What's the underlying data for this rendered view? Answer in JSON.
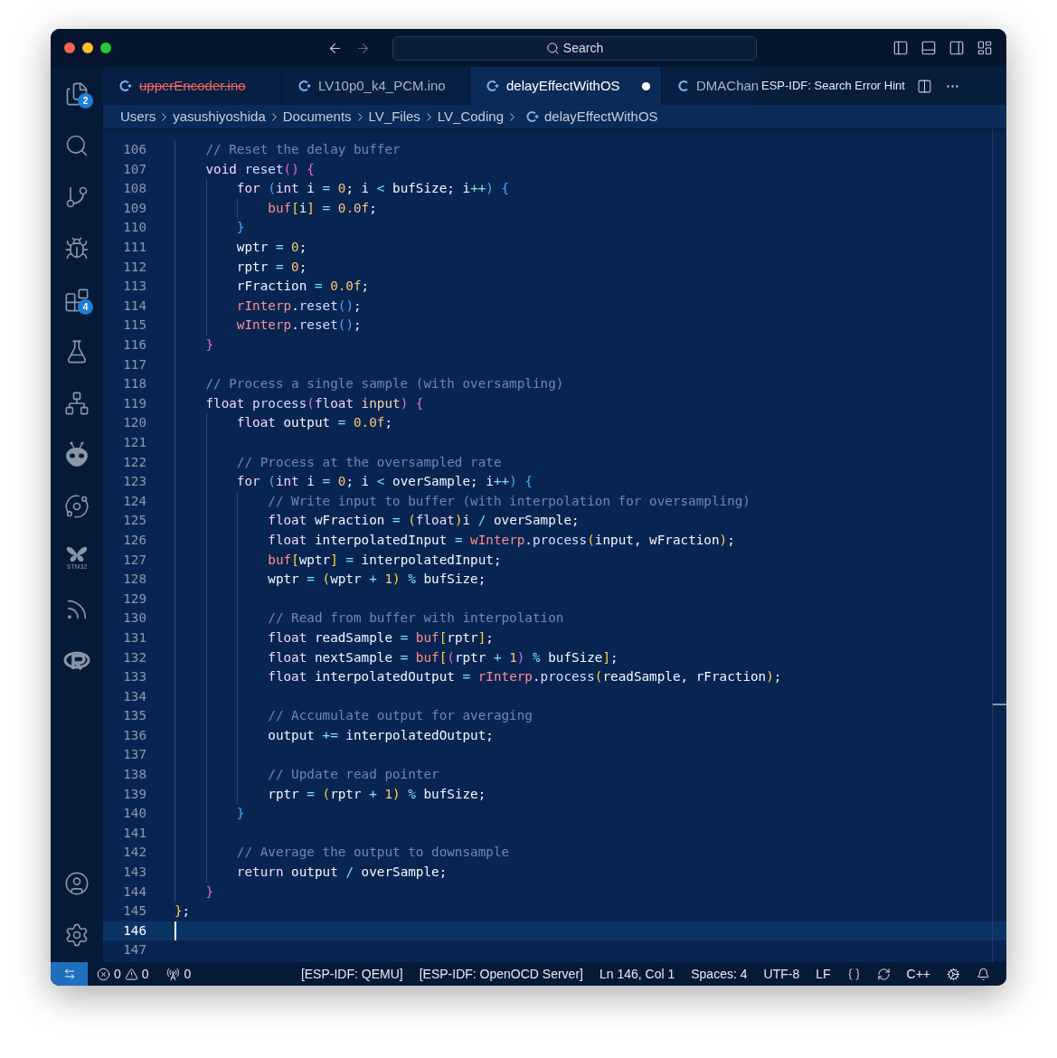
{
  "title_bar": {
    "search": {
      "placeholder": "Search"
    }
  },
  "activity_bar": {
    "items": [
      {
        "kind": "files",
        "badge": "2"
      },
      {
        "kind": "search"
      },
      {
        "kind": "branch"
      },
      {
        "kind": "debug"
      },
      {
        "kind": "extensions",
        "badge": "4"
      },
      {
        "kind": "flask"
      },
      {
        "kind": "circuit"
      },
      {
        "kind": "alien"
      },
      {
        "kind": "swirl"
      },
      {
        "kind": "butterfly",
        "caption": "STM32"
      },
      {
        "kind": "signal"
      },
      {
        "kind": "rlogo"
      }
    ],
    "bottom_items": [
      {
        "kind": "account"
      },
      {
        "kind": "settings"
      }
    ]
  },
  "tabs": [
    {
      "label": "upperEncoder.ino",
      "kind": "cpp",
      "selected": false,
      "modified": false,
      "deleted": true
    },
    {
      "label": "LV10p0_k4_PCM.ino",
      "kind": "cpp",
      "selected": false,
      "modified": false,
      "deleted": false
    },
    {
      "label": "delayEffectWithOS",
      "kind": "cpp",
      "selected": true,
      "modified": true,
      "deleted": false
    },
    {
      "label": "DMAChan",
      "kind": "c",
      "selected": false,
      "modified": false,
      "deleted": false
    }
  ],
  "editor_actions": {
    "hint": "ESP-IDF: Search Error Hint"
  },
  "breadcrumb": [
    {
      "label": "Users",
      "kind": "folder"
    },
    {
      "label": "yasushiyoshida",
      "kind": "folder"
    },
    {
      "label": "Documents",
      "kind": "folder"
    },
    {
      "label": "LV_Files",
      "kind": "folder"
    },
    {
      "label": "LV_Coding",
      "kind": "folder"
    },
    {
      "label": "delayEffectWithOS",
      "kind": "cpp"
    }
  ],
  "editor": {
    "lines": [
      {
        "number": "106",
        "current": false,
        "tokens": [
          {
            "text": "    // Reset the delay buffer",
            "kind": "comment"
          }
        ]
      },
      {
        "number": "107",
        "current": false,
        "tokens": [
          {
            "text": "    void",
            "kind": "keyword"
          },
          {
            "text": " reset",
            "kind": "function"
          },
          {
            "text": "()",
            "kind": "pink"
          },
          {
            "text": " {",
            "kind": "pink"
          }
        ]
      },
      {
        "number": "108",
        "current": false,
        "tokens": [
          {
            "text": "        for",
            "kind": "keyword"
          },
          {
            "text": " (",
            "kind": "blue"
          },
          {
            "text": "int",
            "kind": "keyword"
          },
          {
            "text": " i ",
            "kind": "plain"
          },
          {
            "text": "=",
            "kind": "operator"
          },
          {
            "text": " 0",
            "kind": "number"
          },
          {
            "text": "; i ",
            "kind": "plain"
          },
          {
            "text": "<",
            "kind": "operator"
          },
          {
            "text": " bufSize; i",
            "kind": "plain"
          },
          {
            "text": "++",
            "kind": "operator"
          },
          {
            "text": ")",
            "kind": "blue"
          },
          {
            "text": " {",
            "kind": "blue"
          }
        ]
      },
      {
        "number": "109",
        "current": false,
        "tokens": [
          {
            "text": "            buf",
            "kind": "member"
          },
          {
            "text": "[",
            "kind": "gold"
          },
          {
            "text": "i",
            "kind": "plain"
          },
          {
            "text": "]",
            "kind": "gold"
          },
          {
            "text": " =",
            "kind": "operator"
          },
          {
            "text": " 0.0f",
            "kind": "number"
          },
          {
            "text": ";",
            "kind": "plain"
          }
        ]
      },
      {
        "number": "110",
        "current": false,
        "tokens": [
          {
            "text": "        }",
            "kind": "blue"
          }
        ]
      },
      {
        "number": "111",
        "current": false,
        "tokens": [
          {
            "text": "        wptr ",
            "kind": "plain"
          },
          {
            "text": "=",
            "kind": "operator"
          },
          {
            "text": " 0",
            "kind": "number"
          },
          {
            "text": ";",
            "kind": "plain"
          }
        ]
      },
      {
        "number": "112",
        "current": false,
        "tokens": [
          {
            "text": "        rptr ",
            "kind": "plain"
          },
          {
            "text": "=",
            "kind": "operator"
          },
          {
            "text": " 0",
            "kind": "number"
          },
          {
            "text": ";",
            "kind": "plain"
          }
        ]
      },
      {
        "number": "113",
        "current": false,
        "tokens": [
          {
            "text": "        rFraction ",
            "kind": "plain"
          },
          {
            "text": "=",
            "kind": "operator"
          },
          {
            "text": " 0.0f",
            "kind": "number"
          },
          {
            "text": ";",
            "kind": "plain"
          }
        ]
      },
      {
        "number": "114",
        "current": false,
        "tokens": [
          {
            "text": "        rInterp",
            "kind": "member"
          },
          {
            "text": ".",
            "kind": "plain"
          },
          {
            "text": "reset",
            "kind": "function"
          },
          {
            "text": "()",
            "kind": "blue"
          },
          {
            "text": ";",
            "kind": "plain"
          }
        ]
      },
      {
        "number": "115",
        "current": false,
        "tokens": [
          {
            "text": "        wInterp",
            "kind": "member"
          },
          {
            "text": ".",
            "kind": "plain"
          },
          {
            "text": "reset",
            "kind": "function"
          },
          {
            "text": "()",
            "kind": "blue"
          },
          {
            "text": ";",
            "kind": "plain"
          }
        ]
      },
      {
        "number": "116",
        "current": false,
        "tokens": [
          {
            "text": "    }",
            "kind": "pink"
          }
        ]
      },
      {
        "number": "117",
        "current": false
      },
      {
        "number": "118",
        "current": false,
        "tokens": [
          {
            "text": "    // Process a single sample (with oversampling)",
            "kind": "comment"
          }
        ]
      },
      {
        "number": "119",
        "current": false,
        "tokens": [
          {
            "text": "    float",
            "kind": "keyword"
          },
          {
            "text": " process",
            "kind": "function"
          },
          {
            "text": "(",
            "kind": "pink"
          },
          {
            "text": "float",
            "kind": "keyword"
          },
          {
            "text": " input",
            "kind": "parameter"
          },
          {
            "text": ")",
            "kind": "pink"
          },
          {
            "text": " {",
            "kind": "pink"
          }
        ]
      },
      {
        "number": "120",
        "current": false,
        "tokens": [
          {
            "text": "        float",
            "kind": "keyword"
          },
          {
            "text": " output ",
            "kind": "plain"
          },
          {
            "text": "=",
            "kind": "operator"
          },
          {
            "text": " 0.0f",
            "kind": "number"
          },
          {
            "text": ";",
            "kind": "plain"
          }
        ]
      },
      {
        "number": "121",
        "current": false
      },
      {
        "number": "122",
        "current": false,
        "tokens": [
          {
            "text": "        // Process at the oversampled rate",
            "kind": "comment"
          }
        ]
      },
      {
        "number": "123",
        "current": false,
        "tokens": [
          {
            "text": "        for",
            "kind": "keyword"
          },
          {
            "text": " (",
            "kind": "blue"
          },
          {
            "text": "int",
            "kind": "keyword"
          },
          {
            "text": " i ",
            "kind": "plain"
          },
          {
            "text": "=",
            "kind": "operator"
          },
          {
            "text": " 0",
            "kind": "number"
          },
          {
            "text": "; i ",
            "kind": "plain"
          },
          {
            "text": "<",
            "kind": "operator"
          },
          {
            "text": " overSample; i",
            "kind": "plain"
          },
          {
            "text": "++",
            "kind": "operator"
          },
          {
            "text": ")",
            "kind": "blue"
          },
          {
            "text": " {",
            "kind": "blue"
          }
        ]
      },
      {
        "number": "124",
        "current": false,
        "tokens": [
          {
            "text": "            // Write input to buffer (with interpolation for oversampling)",
            "kind": "comment"
          }
        ]
      },
      {
        "number": "125",
        "current": false,
        "tokens": [
          {
            "text": "            float",
            "kind": "keyword"
          },
          {
            "text": " wFraction ",
            "kind": "plain"
          },
          {
            "text": "=",
            "kind": "operator"
          },
          {
            "text": " (",
            "kind": "gold"
          },
          {
            "text": "float",
            "kind": "keyword"
          },
          {
            "text": ")",
            "kind": "gold"
          },
          {
            "text": "i ",
            "kind": "plain"
          },
          {
            "text": "/",
            "kind": "operator"
          },
          {
            "text": " overSample;",
            "kind": "plain"
          }
        ]
      },
      {
        "number": "126",
        "current": false,
        "tokens": [
          {
            "text": "            float",
            "kind": "keyword"
          },
          {
            "text": " interpolatedInput ",
            "kind": "plain"
          },
          {
            "text": "=",
            "kind": "operator"
          },
          {
            "text": " wInterp",
            "kind": "member"
          },
          {
            "text": ".",
            "kind": "plain"
          },
          {
            "text": "process",
            "kind": "function"
          },
          {
            "text": "(",
            "kind": "gold"
          },
          {
            "text": "input, wFraction",
            "kind": "plain"
          },
          {
            "text": ")",
            "kind": "gold"
          },
          {
            "text": ";",
            "kind": "plain"
          }
        ]
      },
      {
        "number": "127",
        "current": false,
        "tokens": [
          {
            "text": "            buf",
            "kind": "member"
          },
          {
            "text": "[",
            "kind": "gold"
          },
          {
            "text": "wptr",
            "kind": "plain"
          },
          {
            "text": "]",
            "kind": "gold"
          },
          {
            "text": " =",
            "kind": "operator"
          },
          {
            "text": " interpolatedInput;",
            "kind": "plain"
          }
        ]
      },
      {
        "number": "128",
        "current": false,
        "tokens": [
          {
            "text": "            wptr ",
            "kind": "plain"
          },
          {
            "text": "=",
            "kind": "operator"
          },
          {
            "text": " (",
            "kind": "gold"
          },
          {
            "text": "wptr ",
            "kind": "plain"
          },
          {
            "text": "+",
            "kind": "operator"
          },
          {
            "text": " 1",
            "kind": "number"
          },
          {
            "text": ")",
            "kind": "gold"
          },
          {
            "text": " %",
            "kind": "operator"
          },
          {
            "text": " bufSize;",
            "kind": "plain"
          }
        ]
      },
      {
        "number": "129",
        "current": false
      },
      {
        "number": "130",
        "current": false,
        "tokens": [
          {
            "text": "            // Read from buffer with interpolation",
            "kind": "comment"
          }
        ]
      },
      {
        "number": "131",
        "current": false,
        "tokens": [
          {
            "text": "            float",
            "kind": "keyword"
          },
          {
            "text": " readSample ",
            "kind": "plain"
          },
          {
            "text": "=",
            "kind": "operator"
          },
          {
            "text": " buf",
            "kind": "member"
          },
          {
            "text": "[",
            "kind": "gold"
          },
          {
            "text": "rptr",
            "kind": "plain"
          },
          {
            "text": "]",
            "kind": "gold"
          },
          {
            "text": ";",
            "kind": "plain"
          }
        ]
      },
      {
        "number": "132",
        "current": false,
        "tokens": [
          {
            "text": "            float",
            "kind": "keyword"
          },
          {
            "text": " nextSample ",
            "kind": "plain"
          },
          {
            "text": "=",
            "kind": "operator"
          },
          {
            "text": " buf",
            "kind": "member"
          },
          {
            "text": "[",
            "kind": "gold"
          },
          {
            "text": "(",
            "kind": "pink"
          },
          {
            "text": "rptr ",
            "kind": "plain"
          },
          {
            "text": "+",
            "kind": "operator"
          },
          {
            "text": " 1",
            "kind": "number"
          },
          {
            "text": ")",
            "kind": "pink"
          },
          {
            "text": " %",
            "kind": "operator"
          },
          {
            "text": " bufSize",
            "kind": "plain"
          },
          {
            "text": "]",
            "kind": "gold"
          },
          {
            "text": ";",
            "kind": "plain"
          }
        ]
      },
      {
        "number": "133",
        "current": false,
        "tokens": [
          {
            "text": "            float",
            "kind": "keyword"
          },
          {
            "text": " interpolatedOutput ",
            "kind": "plain"
          },
          {
            "text": "=",
            "kind": "operator"
          },
          {
            "text": " rInterp",
            "kind": "member"
          },
          {
            "text": ".",
            "kind": "plain"
          },
          {
            "text": "process",
            "kind": "function"
          },
          {
            "text": "(",
            "kind": "gold"
          },
          {
            "text": "readSample, rFraction",
            "kind": "plain"
          },
          {
            "text": ")",
            "kind": "gold"
          },
          {
            "text": ";",
            "kind": "plain"
          }
        ]
      },
      {
        "number": "134",
        "current": false
      },
      {
        "number": "135",
        "current": false,
        "tokens": [
          {
            "text": "            // Accumulate output for averaging",
            "kind": "comment"
          }
        ]
      },
      {
        "number": "136",
        "current": false,
        "tokens": [
          {
            "text": "            output ",
            "kind": "plain"
          },
          {
            "text": "+=",
            "kind": "operator"
          },
          {
            "text": " interpolatedOutput;",
            "kind": "plain"
          }
        ]
      },
      {
        "number": "137",
        "current": false
      },
      {
        "number": "138",
        "current": false,
        "tokens": [
          {
            "text": "            // Update read pointer",
            "kind": "comment"
          }
        ]
      },
      {
        "number": "139",
        "current": false,
        "tokens": [
          {
            "text": "            rptr ",
            "kind": "plain"
          },
          {
            "text": "=",
            "kind": "operator"
          },
          {
            "text": " (",
            "kind": "gold"
          },
          {
            "text": "rptr ",
            "kind": "plain"
          },
          {
            "text": "+",
            "kind": "operator"
          },
          {
            "text": " 1",
            "kind": "number"
          },
          {
            "text": ")",
            "kind": "gold"
          },
          {
            "text": " %",
            "kind": "operator"
          },
          {
            "text": " bufSize;",
            "kind": "plain"
          }
        ]
      },
      {
        "number": "140",
        "current": false,
        "tokens": [
          {
            "text": "        }",
            "kind": "blue"
          }
        ]
      },
      {
        "number": "141",
        "current": false
      },
      {
        "number": "142",
        "current": false,
        "tokens": [
          {
            "text": "        // Average the output to downsample",
            "kind": "comment"
          }
        ]
      },
      {
        "number": "143",
        "current": false,
        "tokens": [
          {
            "text": "        return",
            "kind": "keyword"
          },
          {
            "text": " output ",
            "kind": "plain"
          },
          {
            "text": "/",
            "kind": "operator"
          },
          {
            "text": " overSample;",
            "kind": "plain"
          }
        ]
      },
      {
        "number": "144",
        "current": false,
        "tokens": [
          {
            "text": "    }",
            "kind": "pink"
          }
        ]
      },
      {
        "number": "145",
        "current": false,
        "tokens": [
          {
            "text": "}",
            "kind": "gold"
          },
          {
            "text": ";",
            "kind": "plain"
          }
        ]
      },
      {
        "number": "146",
        "current": true
      },
      {
        "number": "147",
        "current": false
      }
    ]
  },
  "status_bar": {
    "errors": "0",
    "warnings": "0",
    "ports": "0",
    "items": [
      {
        "kind": "text",
        "text": "[ESP-IDF: QEMU]"
      },
      {
        "kind": "text",
        "text": "[ESP-IDF: OpenOCD Server]"
      },
      {
        "kind": "text",
        "text": "Ln 146, Col 1"
      },
      {
        "kind": "text",
        "text": "Spaces: 4"
      },
      {
        "kind": "text",
        "text": "UTF-8"
      },
      {
        "kind": "text",
        "text": "LF"
      },
      {
        "kind": "braces"
      },
      {
        "kind": "sync"
      },
      {
        "kind": "text",
        "text": "C++"
      },
      {
        "kind": "gear"
      },
      {
        "kind": "bell"
      }
    ]
  }
}
